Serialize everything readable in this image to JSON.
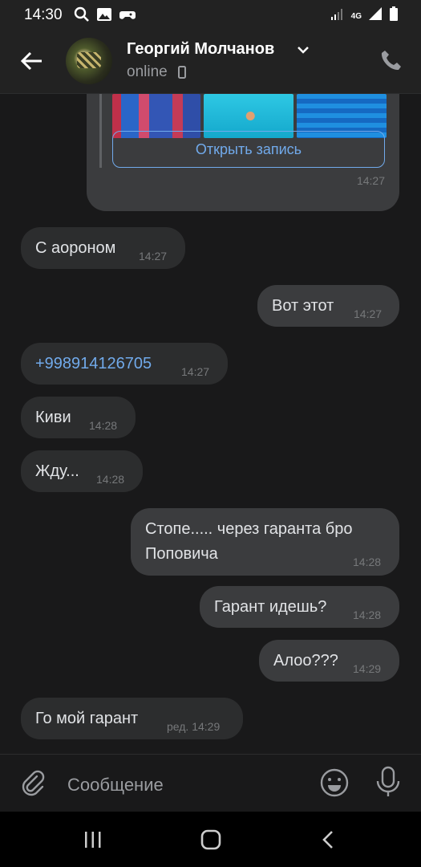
{
  "status_bar": {
    "time": "14:30",
    "network": "4G"
  },
  "header": {
    "contact_name": "Георгий Молчанов",
    "status": "online"
  },
  "shared_post": {
    "open_button": "Открыть запись",
    "time": "14:27"
  },
  "messages": [
    {
      "direction": "in",
      "text": "С аороном",
      "time": "14:27"
    },
    {
      "direction": "out",
      "text": "Вот этот",
      "time": "14:27"
    },
    {
      "direction": "in",
      "text": "+998914126705",
      "time": "14:27",
      "is_link": true
    },
    {
      "direction": "in",
      "text": "Киви",
      "time": "14:28"
    },
    {
      "direction": "in",
      "text": "Жду...",
      "time": "14:28"
    },
    {
      "direction": "out",
      "text": "Стопе..... через гаранта бро",
      "text2": "Поповича",
      "time": "14:28"
    },
    {
      "direction": "out",
      "text": "Гарант идешь?",
      "time": "14:28"
    },
    {
      "direction": "out",
      "text": "Алоо???",
      "time": "14:29"
    },
    {
      "direction": "in",
      "text": "Го мой гарант",
      "time": "ред. 14:29"
    }
  ],
  "composer": {
    "placeholder": "Сообщение"
  },
  "colors": {
    "background": "#19191a",
    "bubble_in": "#2c2d2e",
    "bubble_out": "#3b3c3e",
    "accent": "#71aaeb",
    "header": "#222222"
  }
}
